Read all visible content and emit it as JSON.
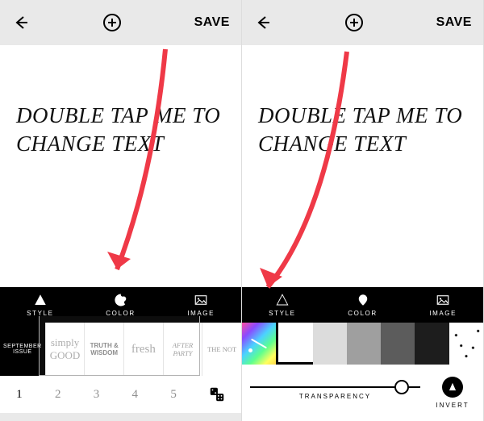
{
  "left": {
    "header": {
      "save_label": "SAVE"
    },
    "canvas_text": "DOUBLE TAP ME TO CHANGE TEXT",
    "tabs": {
      "style": "STYLE",
      "color": "COLOR",
      "image": "IMAGE"
    },
    "styles": [
      {
        "label": "SEPTEMBER ISSUE"
      },
      {
        "label": "simply GOOD"
      },
      {
        "label": "TRUTH & WISDOM"
      },
      {
        "label": "fresh"
      },
      {
        "label": "AFTER PARTY"
      },
      {
        "label": "THE NOT"
      }
    ],
    "numbers": [
      "1",
      "2",
      "3",
      "4",
      "5"
    ]
  },
  "right": {
    "header": {
      "save_label": "SAVE"
    },
    "canvas_text": "DOUBLE TAP ME TO CHANGE TEXT",
    "tabs": {
      "style": "STYLE",
      "color": "COLOR",
      "image": "IMAGE"
    },
    "slider_label": "TRANSPARENCY",
    "invert_label": "INVERT"
  }
}
